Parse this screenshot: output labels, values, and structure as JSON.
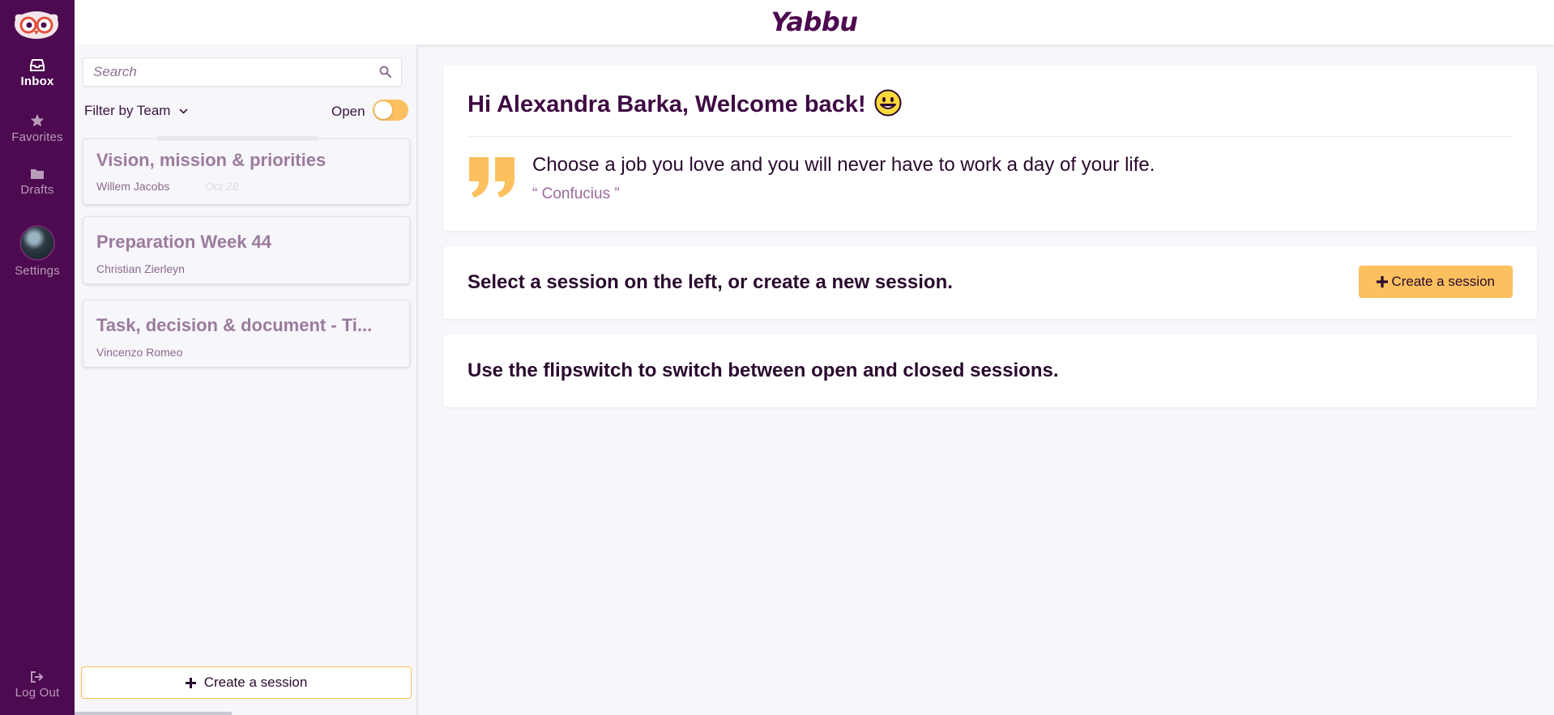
{
  "brand": {
    "name": "Yabbu"
  },
  "nav": {
    "inbox": "Inbox",
    "favorites": "Favorites",
    "drafts": "Drafts",
    "settings": "Settings",
    "logout": "Log Out"
  },
  "sidebar": {
    "search_placeholder": "Search",
    "filter_label": "Filter by Team",
    "open_label": "Open",
    "open_toggle_on": false,
    "sessions": [
      {
        "title": "Vision, mission & priorities",
        "owner": "Willem Jacobs",
        "date": "Oct 28"
      },
      {
        "title": "Preparation Week 44",
        "owner": "Christian Zierleyn"
      },
      {
        "title": "Task, decision & document - Ti...",
        "owner": "Vincenzo Romeo"
      }
    ],
    "create_label": "Create a session"
  },
  "main": {
    "welcome": "Hi Alexandra Barka, Welcome back!",
    "quote": "Choose a job you love and you will never have to work a day of your life.",
    "quote_author": "“ Confucius ”",
    "select_message": "Select a session on the left, or create a new session.",
    "create_label": "Create a session",
    "flip_message": "Use the flipswitch to switch between open and closed sessions."
  },
  "colors": {
    "rail": "#4d0a50",
    "accent": "#fcc05e",
    "brand_text": "#4d0a50",
    "muted_title": "#9b7b9d"
  }
}
